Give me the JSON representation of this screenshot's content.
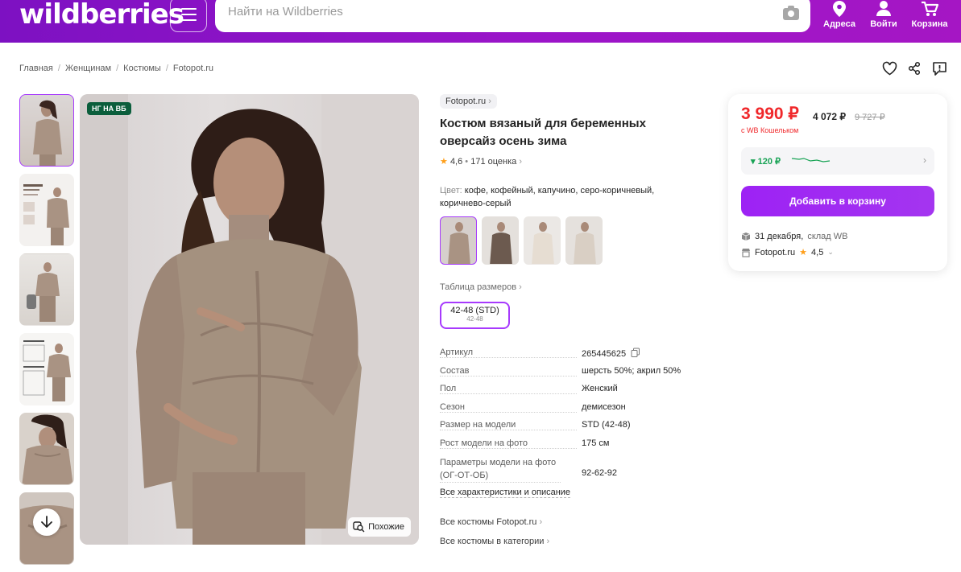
{
  "header": {
    "logo": "wildberries",
    "search_placeholder": "Найти на Wildberries",
    "nav": [
      {
        "label": "Адреса",
        "icon": "location-pin-icon"
      },
      {
        "label": "Войти",
        "icon": "user-icon"
      },
      {
        "label": "Корзина",
        "icon": "cart-icon"
      }
    ]
  },
  "breadcrumbs": [
    "Главная",
    "Женщинам",
    "Костюмы",
    "Fotopot.ru"
  ],
  "gallery": {
    "badge": "НГ НА ВБ",
    "similar_label": "Похожие"
  },
  "product": {
    "brand": "Fotopot.ru",
    "title": "Костюм вязаный для беременных оверсайз осень зима",
    "rating": "4,6",
    "reviews": "171 оценка",
    "color_label": "Цвет:",
    "color_value": "кофе, кофейный, капучино, серо-коричневый, коричнево-серый",
    "size_table_label": "Таблица размеров",
    "size_main": "42-48 (STD)",
    "size_sub": "42-48"
  },
  "specs": [
    {
      "k": "Артикул",
      "v": "265445625"
    },
    {
      "k": "Состав",
      "v": "шерсть 50%; акрил 50%"
    },
    {
      "k": "Пол",
      "v": "Женский"
    },
    {
      "k": "Сезон",
      "v": "демисезон"
    },
    {
      "k": "Размер на модели",
      "v": "STD (42-48)"
    },
    {
      "k": "Рост модели на фото",
      "v": "175 см"
    },
    {
      "k": "Параметры модели на фото (ОГ-ОТ-ОБ)",
      "v": "92-62-92"
    }
  ],
  "links": {
    "all_chars": "Все характеристики и описание",
    "brand_costumes": "Все костюмы Fotopot.ru",
    "category_costumes": "Все костюмы в категории"
  },
  "price": {
    "main": "3 990 ₽",
    "alt": "4 072 ₽",
    "old": "9 727 ₽",
    "wallet_note": "с WB Кошельком",
    "history_drop": "▾ 120 ₽",
    "add_to_cart": "Добавить в корзину",
    "delivery_date": "31 декабря,",
    "delivery_warehouse": "склад WB",
    "seller": "Fotopot.ru",
    "seller_rating": "4,5"
  },
  "colors": {
    "accent": "#a73afd",
    "price_red": "#f0272a",
    "header_purple": "#8a12c4",
    "badge_green": "#0b5e3c"
  }
}
